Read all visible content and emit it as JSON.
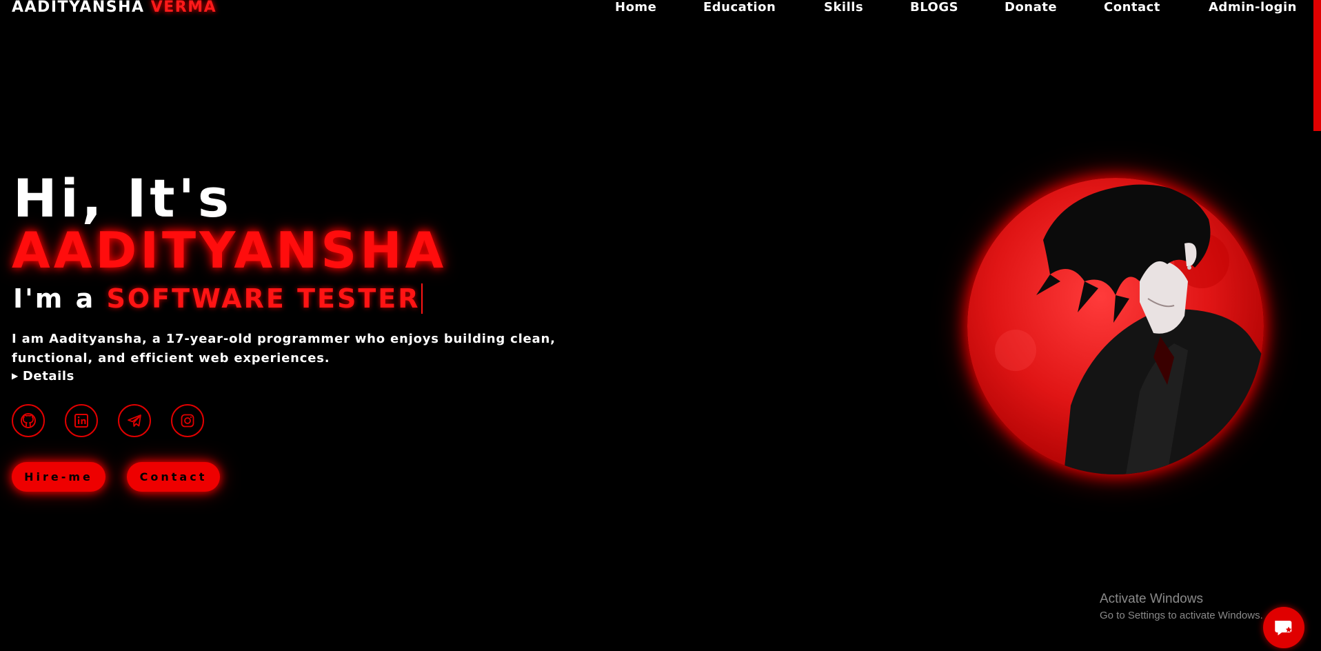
{
  "header": {
    "logo_first": "AADITYANSHA",
    "logo_last": "VERMA",
    "nav": [
      "Home",
      "Education",
      "Skills",
      "BLOGS",
      "Donate",
      "Contact",
      "Admin-login"
    ]
  },
  "hero": {
    "greeting": "Hi, It's",
    "name": "AADITYANSHA",
    "role_prefix": "I'm a",
    "role_typed": "SOFTWARE TESTER",
    "intro": "I am Aadityansha, a 17-year-old programmer who enjoys building clean, functional, and efficient web experiences.",
    "details_label": "Details"
  },
  "socials": [
    {
      "name": "github",
      "icon": "github-icon"
    },
    {
      "name": "linkedin",
      "icon": "linkedin-icon"
    },
    {
      "name": "telegram",
      "icon": "telegram-icon"
    },
    {
      "name": "instagram",
      "icon": "instagram-icon"
    }
  ],
  "buttons": {
    "hire": "Hire-me",
    "contact": "Contact"
  },
  "watermark": {
    "title": "Activate Windows",
    "subtitle": "Go to Settings to activate Windows."
  },
  "colors": {
    "background": "#000000",
    "accent": "#ff0d0d",
    "text": "#ffffff"
  }
}
